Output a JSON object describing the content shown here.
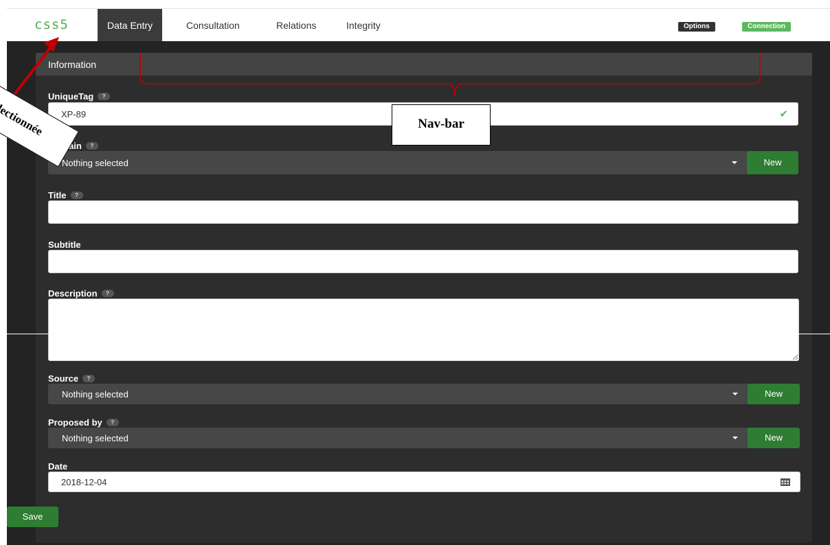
{
  "navbar": {
    "brand": "css5",
    "items": [
      {
        "label": "Data Entry",
        "active": true
      },
      {
        "label": "Consultation",
        "active": false
      },
      {
        "label": "Relations",
        "active": false
      },
      {
        "label": "Integrity",
        "active": false
      }
    ],
    "options_label": "Options",
    "connection_label": "Connection"
  },
  "panel": {
    "title": "Information",
    "help_glyph": "?",
    "fields": {
      "uniquetag": {
        "label": "UniqueTag",
        "value": "XP-89"
      },
      "domain": {
        "label": "ain",
        "value": "Nothing selected",
        "new_label": "New"
      },
      "title": {
        "label": "Title",
        "value": ""
      },
      "subtitle": {
        "label": "Subtitle",
        "value": ""
      },
      "description": {
        "label": "Description",
        "value": ""
      },
      "source": {
        "label": "Source",
        "value": "Nothing selected",
        "new_label": "New"
      },
      "proposed_by": {
        "label": "Proposed by",
        "value": "Nothing selected",
        "new_label": "New"
      },
      "date": {
        "label": "Date",
        "value": "2018-12-04"
      }
    },
    "save_label": "Save"
  },
  "annotations": {
    "navbar_callout": "Nav-bar",
    "selected_callout": "lectionnée"
  },
  "colors": {
    "brand": "#4caf50",
    "accent_green": "#2e7d32",
    "connection_green": "#5cb85c",
    "panel_bg": "#2d2d2d",
    "arrow_red": "#c00000"
  },
  "icons": {
    "valid": "check-icon",
    "calendar": "calendar-icon",
    "dropdown": "caret-down-icon"
  }
}
